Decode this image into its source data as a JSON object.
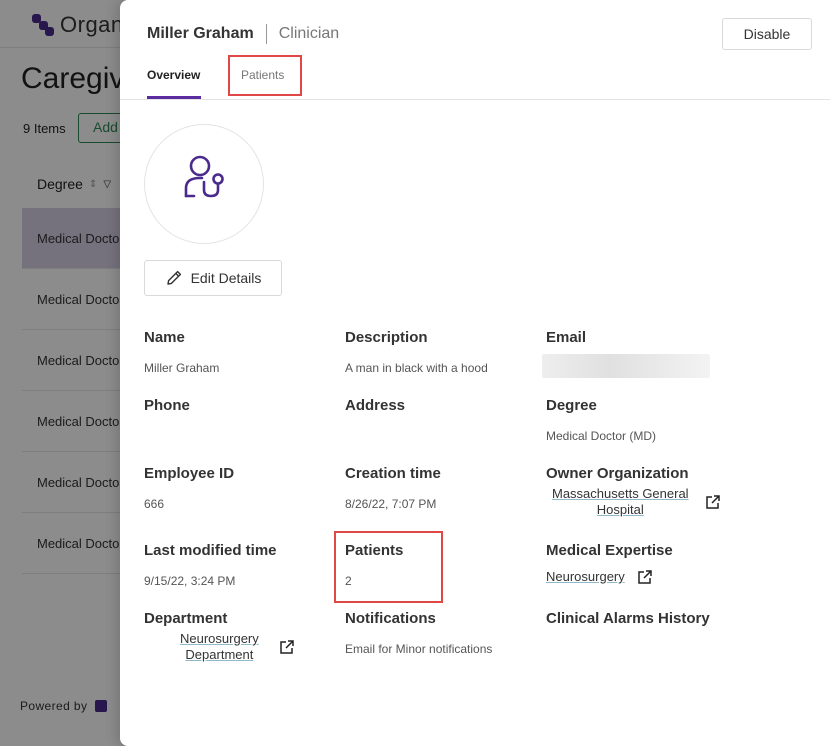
{
  "background": {
    "logo_text": "Organ",
    "page_title": "Caregiv",
    "items_count": "9 Items",
    "add_label": "Add",
    "column_header": "Degree",
    "rows": [
      "Medical Docto",
      "Medical Docto",
      "Medical Docto",
      "Medical Docto",
      "Medical Docto",
      "Medical Docto"
    ],
    "footer": "Powered by"
  },
  "drawer": {
    "name": "Miller Graham",
    "role": "Clinician",
    "disable_label": "Disable",
    "tabs": [
      {
        "label": "Overview",
        "active": true
      },
      {
        "label": "Patients",
        "active": false
      }
    ],
    "edit_label": "Edit Details",
    "fields": {
      "name": {
        "label": "Name",
        "value": "Miller Graham"
      },
      "description": {
        "label": "Description",
        "value": "A man in black with a hood"
      },
      "email": {
        "label": "Email",
        "value": ""
      },
      "phone": {
        "label": "Phone",
        "value": ""
      },
      "address": {
        "label": "Address",
        "value": ""
      },
      "degree": {
        "label": "Degree",
        "value": "Medical Doctor (MD)"
      },
      "employee_id": {
        "label": "Employee ID",
        "value": "666"
      },
      "creation_time": {
        "label": "Creation time",
        "value": "8/26/22, 7:07 PM"
      },
      "owner_org": {
        "label": "Owner Organization",
        "line1": "Massachusetts General",
        "line2": "Hospital"
      },
      "last_modified": {
        "label": "Last modified time",
        "value": "9/15/22, 3:24 PM"
      },
      "patients": {
        "label": "Patients",
        "value": "2"
      },
      "expertise": {
        "label": "Medical Expertise",
        "value": "Neurosurgery"
      },
      "department": {
        "label": "Department",
        "line1": "Neurosurgery",
        "line2": "Department"
      },
      "notifications": {
        "label": "Notifications",
        "value": "Email for Minor notifications"
      },
      "alarms": {
        "label": "Clinical Alarms History",
        "value": ""
      }
    }
  },
  "colors": {
    "accent": "#5a2ca0",
    "highlight": "#e04848",
    "link_underline": "#8fb8c8"
  }
}
